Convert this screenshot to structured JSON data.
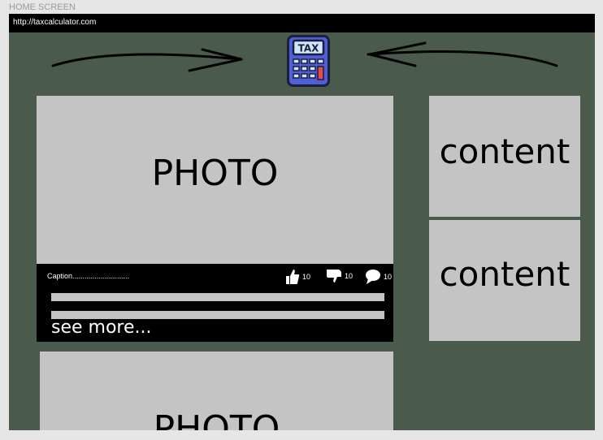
{
  "screen_label": "HOME SCREEN",
  "url": "http://taxcalculator.com",
  "logo": {
    "icon": "calculator-icon",
    "text": "TAX"
  },
  "feed": {
    "posts": [
      {
        "photo_label": "PHOTO",
        "caption": "Caption............................",
        "likes": "10",
        "dislikes": "10",
        "comments": "10",
        "see_more": "see more..."
      },
      {
        "photo_label": "PHOTO"
      }
    ]
  },
  "sidebar": {
    "cards": [
      {
        "label": "content"
      },
      {
        "label": "content"
      }
    ]
  },
  "colors": {
    "background": "#4a5a4c",
    "card": "#c4c4c4",
    "bar": "#000000",
    "calculator_body": "#4f5fd6"
  }
}
